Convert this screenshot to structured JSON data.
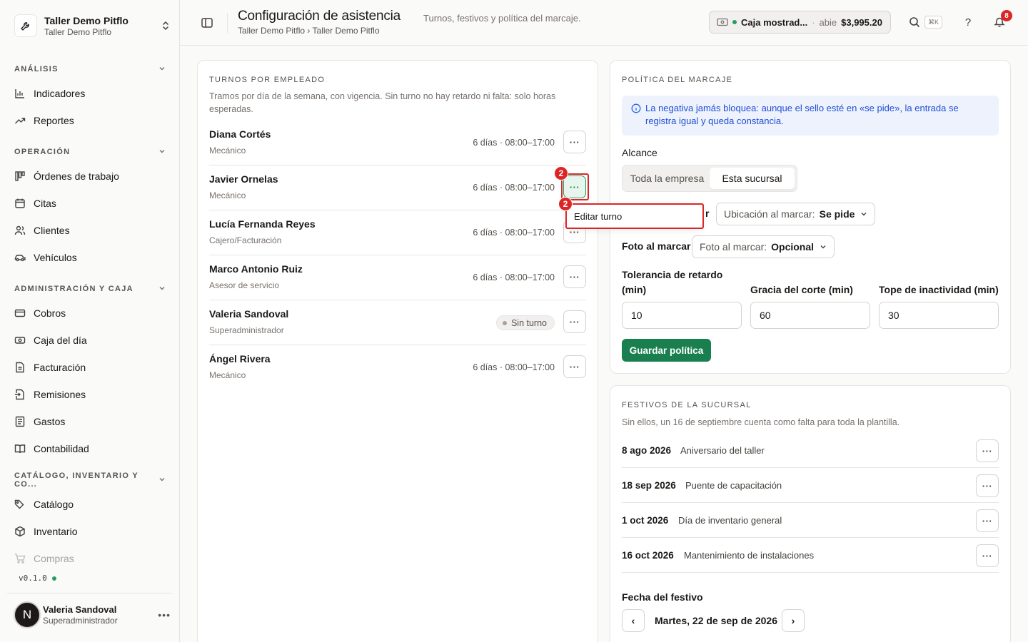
{
  "org": {
    "name": "Taller Demo Pitflo",
    "subtitle": "Taller Demo Pitflo"
  },
  "sidebar": {
    "sections": [
      {
        "title": "ANÁLISIS",
        "items": [
          {
            "label": "Indicadores",
            "icon": "chart-bars-icon"
          },
          {
            "label": "Reportes",
            "icon": "trend-up-icon"
          }
        ]
      },
      {
        "title": "OPERACIÓN",
        "items": [
          {
            "label": "Órdenes de trabajo",
            "icon": "kanban-icon"
          },
          {
            "label": "Citas",
            "icon": "calendar-icon"
          },
          {
            "label": "Clientes",
            "icon": "users-icon"
          },
          {
            "label": "Vehículos",
            "icon": "car-icon"
          }
        ]
      },
      {
        "title": "ADMINISTRACIÓN Y CAJA",
        "items": [
          {
            "label": "Cobros",
            "icon": "credit-card-icon"
          },
          {
            "label": "Caja del día",
            "icon": "cash-icon"
          },
          {
            "label": "Facturación",
            "icon": "file-icon"
          },
          {
            "label": "Remisiones",
            "icon": "file-arrow-icon"
          },
          {
            "label": "Gastos",
            "icon": "receipt-icon"
          },
          {
            "label": "Contabilidad",
            "icon": "book-icon"
          }
        ]
      },
      {
        "title": "CATÁLOGO, INVENTARIO Y CO...",
        "items": [
          {
            "label": "Catálogo",
            "icon": "tags-icon"
          },
          {
            "label": "Inventario",
            "icon": "box-icon"
          },
          {
            "label": "Compras",
            "icon": "cart-icon"
          }
        ]
      }
    ],
    "version": "v0.1.0",
    "user": {
      "initial": "N",
      "name": "Valeria Sandoval",
      "role": "Superadministrador"
    }
  },
  "header": {
    "title": "Configuración de asistencia",
    "subtitle": "Turnos, festivos y política del marcaje.",
    "breadcrumb": "Taller Demo Pitflo › Taller Demo Pitflo",
    "caja": {
      "name": "Caja mostrad...",
      "separator": "·",
      "state": "abie",
      "amount": "$3,995.20"
    },
    "shortcut": "⌘K",
    "help": "?",
    "notifications": "8"
  },
  "shifts": {
    "label": "TURNOS POR EMPLEADO",
    "description": "Tramos por día de la semana, con vigencia. Sin turno no hay retardo ni falta: solo horas esperadas.",
    "employees": [
      {
        "name": "Diana Cortés",
        "role": "Mecánico",
        "schedule": "6 días · 08:00–17:00"
      },
      {
        "name": "Javier Ornelas",
        "role": "Mecánico",
        "schedule": "6 días · 08:00–17:00"
      },
      {
        "name": "Lucía Fernanda Reyes",
        "role": "Cajero/Facturación",
        "schedule": "6 días · 08:00–17:00"
      },
      {
        "name": "Marco Antonio Ruiz",
        "role": "Asesor de servicio",
        "schedule": "6 días · 08:00–17:00"
      },
      {
        "name": "Valeria Sandoval",
        "role": "Superadministrador",
        "schedule": "",
        "badge": "Sin turno"
      },
      {
        "name": "Ángel Rivera",
        "role": "Mecánico",
        "schedule": "6 días · 08:00–17:00"
      }
    ],
    "menu_item": "Editar turno",
    "markers": [
      "2",
      "2"
    ]
  },
  "policy": {
    "label": "POLÍTICA DEL MARCAJE",
    "info": "La negativa jamás bloquea: aunque el sello esté en «se pide», la entrada se registra igual y queda constancia.",
    "scope_label": "Alcance",
    "scope_options": [
      "Toda la empresa",
      "Esta sucursal"
    ],
    "location_label_tail": "r",
    "location_select": {
      "label": "Ubicación al marcar:",
      "value": "Se pide"
    },
    "photo_label": "Foto al marcar",
    "photo_select": {
      "label": "Foto al marcar:",
      "value": "Opcional"
    },
    "tolerance_label": "Tolerancia de retardo (min)",
    "tolerance_value": "10",
    "grace_label": "Gracia del corte (min)",
    "grace_value": "60",
    "inactivity_label": "Tope de inactividad (min)",
    "inactivity_value": "30",
    "save_label": "Guardar política"
  },
  "holidays": {
    "label": "FESTIVOS DE LA SUCURSAL",
    "description": "Sin ellos, un 16 de septiembre cuenta como falta para toda la plantilla.",
    "items": [
      {
        "date": "8 ago 2026",
        "name": "Aniversario del taller"
      },
      {
        "date": "18 sep 2026",
        "name": "Puente de capacitación"
      },
      {
        "date": "1 oct 2026",
        "name": "Día de inventario general"
      },
      {
        "date": "16 oct 2026",
        "name": "Mantenimiento de instalaciones"
      }
    ],
    "date_field_label": "Fecha del festivo",
    "date_value": "Martes, 22 de sep de 2026",
    "prev": "‹",
    "next": "›"
  }
}
